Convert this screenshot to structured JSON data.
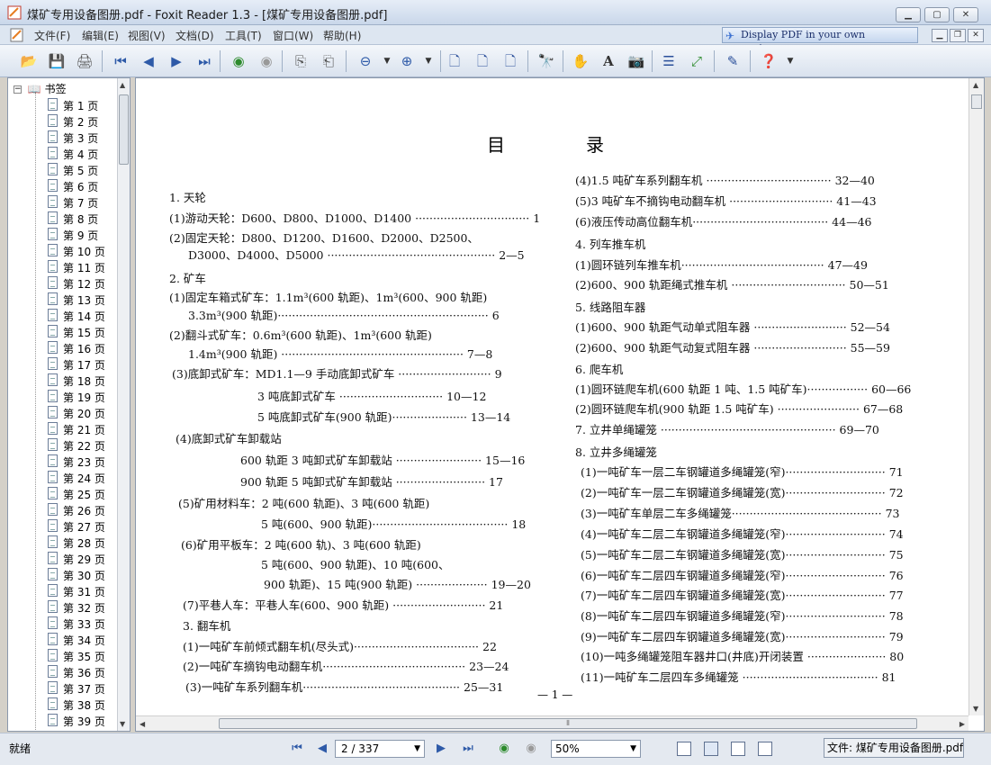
{
  "window": {
    "title": "煤矿专用设备图册.pdf - Foxit Reader 1.3 - [煤矿专用设备图册.pdf]",
    "minimize": "▁",
    "maximize": "▢",
    "close": "✕"
  },
  "menu": {
    "items": [
      "文件(F)",
      "编辑(E)",
      "视图(V)",
      "文档(D)",
      "工具(T)",
      "窗口(W)",
      "帮助(H)"
    ],
    "ad_text": "Display PDF in your own applications"
  },
  "toolbar": {
    "icons": [
      "open-folder-icon",
      "save-icon",
      "print-icon",
      "first-page-icon",
      "prev-page-icon",
      "next-page-icon",
      "last-page-icon",
      "back-icon",
      "forward-icon",
      "rotate-left-icon",
      "rotate-right-icon",
      "zoom-out-icon",
      "zoom-out-dropdown-icon",
      "zoom-in-icon",
      "zoom-in-dropdown-icon",
      "actual-size-icon",
      "fit-page-icon",
      "fit-width-icon",
      "find-icon",
      "hand-tool-icon",
      "text-select-icon",
      "snapshot-icon",
      "bookmarks-toggle-icon",
      "fullscreen-icon",
      "typewriter-icon",
      "help-icon",
      "help-dropdown-icon"
    ]
  },
  "bookmarks": {
    "root_label": "书签",
    "items": [
      "第 1 页",
      "第 2 页",
      "第 3 页",
      "第 4 页",
      "第 5 页",
      "第 6 页",
      "第 7 页",
      "第 8 页",
      "第 9 页",
      "第 10 页",
      "第 11 页",
      "第 12 页",
      "第 13 页",
      "第 14 页",
      "第 15 页",
      "第 16 页",
      "第 17 页",
      "第 18 页",
      "第 19 页",
      "第 20 页",
      "第 21 页",
      "第 22 页",
      "第 23 页",
      "第 24 页",
      "第 25 页",
      "第 26 页",
      "第 27 页",
      "第 28 页",
      "第 29 页",
      "第 30 页",
      "第 31 页",
      "第 32 页",
      "第 33 页",
      "第 34 页",
      "第 35 页",
      "第 36 页",
      "第 37 页",
      "第 38 页",
      "第 39 页"
    ]
  },
  "page": {
    "title_left": "目",
    "title_right": "录",
    "left_column": [
      "1. 天轮",
      "(1)游动天轮：D600、D800、D1000、D1400 ································ 1",
      "(2)固定天轮：D800、D1200、D1600、D2000、D2500、",
      "D3000、D4000、D5000 ··············································· 2—5",
      "2. 矿车",
      "(1)固定车箱式矿车：1.1m³(600 轨距)、1m³(600、900 轨距)",
      "3.3m³(900 轨距)··························································· 6",
      "(2)翻斗式矿车：0.6m³(600 轨距)、1m³(600 轨距)",
      "1.4m³(900 轨距) ··················································· 7—8",
      "(3)底卸式矿车：MD1.1—9 手动底卸式矿车 ·························· 9",
      "3 吨底卸式矿车 ····························· 10—12",
      "5 吨底卸式矿车(900 轨距)····················· 13—14",
      "(4)底卸式矿车卸载站",
      "600 轨距 3 吨卸式矿车卸载站 ························ 15—16",
      "900 轨距 5 吨卸式矿车卸载站 ························· 17",
      "(5)矿用材料车：2 吨(600 轨距)、3 吨(600 轨距)",
      "5 吨(600、900 轨距)······································ 18",
      "(6)矿用平板车：2 吨(600 轨)、3 吨(600 轨距)",
      "5 吨(600、900 轨距)、10 吨(600、",
      "900 轨距)、15 吨(900 轨距) ···················· 19—20",
      "(7)平巷人车：平巷人车(600、900 轨距) ·························· 21",
      "3. 翻车机",
      "(1)一吨矿车前倾式翻车机(尽头式)··································· 22",
      "(2)一吨矿车摘钩电动翻车机········································ 23—24",
      "(3)一吨矿车系列翻车机············································ 25—31"
    ],
    "right_column": [
      "(4)1.5 吨矿车系列翻车机 ··································· 32—40",
      "(5)3 吨矿车不摘钩电动翻车机 ····························· 41—43",
      "(6)液压传动高位翻车机······································ 44—46",
      "4. 列车推车机",
      "(1)圆环链列车推车机········································ 47—49",
      "(2)600、900 轨距绳式推车机 ································ 50—51",
      "5. 线路阻车器",
      "(1)600、900 轨距气动单式阻车器 ·························· 52—54",
      "(2)600、900 轨距气动复式阻车器 ·························· 55—59",
      "6. 爬车机",
      "(1)圆环链爬车机(600 轨距 1 吨、1.5 吨矿车)················· 60—66",
      "(2)圆环链爬车机(900 轨距 1.5 吨矿车) ······················· 67—68",
      "7. 立井单绳罐笼 ················································· 69—70",
      "8. 立井多绳罐笼",
      "(1)一吨矿车一层二车钢罐道多绳罐笼(窄)···························· 71",
      "(2)一吨矿车一层二车钢罐道多绳罐笼(宽)···························· 72",
      "(3)一吨矿车单层二车多绳罐笼·········································· 73",
      "(4)一吨矿车二层二车钢罐道多绳罐笼(窄)···························· 74",
      "(5)一吨矿车二层二车钢罐道多绳罐笼(宽)···························· 75",
      "(6)一吨矿车二层四车钢罐道多绳罐笼(窄)···························· 76",
      "(7)一吨矿车二层四车钢罐道多绳罐笼(宽)···························· 77",
      "(8)一吨矿车二层四车钢罐道多绳罐笼(窄)···························· 78",
      "(9)一吨矿车二层四车钢罐道多绳罐笼(宽)···························· 79",
      "(10)一吨多绳罐笼阻车器井口(井底)开闭装置 ······················ 80",
      "(11)一吨矿车二层四车多绳罐笼 ······································ 81"
    ],
    "page_number": "— 1 —"
  },
  "statusbar": {
    "status": "就绪",
    "page_value": "2 / 337",
    "zoom_value": "50%",
    "file_label": "文件: 煤矿专用设备图册.pdf"
  }
}
